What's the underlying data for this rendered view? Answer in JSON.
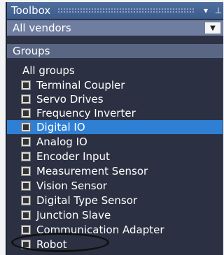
{
  "window": {
    "title": "Toolbox"
  },
  "titlebar_buttons": [
    {
      "label": "▾",
      "icon": "chevron-down-icon"
    },
    {
      "label": "⊥",
      "icon": "pin-icon"
    }
  ],
  "vendor": {
    "selected": "All vendors",
    "arrow": "▼"
  },
  "groups": {
    "header": "Groups"
  },
  "items": [
    {
      "label": "All groups",
      "icon": ""
    },
    {
      "label": "Terminal Coupler",
      "icon": "terminal-coupler-icon"
    },
    {
      "label": "Servo Drives",
      "icon": "servo-drive-icon"
    },
    {
      "label": "Frequency Inverter",
      "icon": "frequency-inverter-icon"
    },
    {
      "label": "Digital IO",
      "icon": "digital-io-icon",
      "selected": true
    },
    {
      "label": "Analog IO",
      "icon": "analog-io-icon"
    },
    {
      "label": "Encoder Input",
      "icon": "encoder-icon"
    },
    {
      "label": "Measurement Sensor",
      "icon": "measurement-sensor-icon"
    },
    {
      "label": "Vision Sensor",
      "icon": "vision-sensor-icon"
    },
    {
      "label": "Digital Type Sensor",
      "icon": "digital-sensor-icon"
    },
    {
      "label": "Junction Slave",
      "icon": "junction-slave-icon"
    },
    {
      "label": "Communication Adapter",
      "icon": "communication-adapter-icon"
    },
    {
      "label": "Robot",
      "icon": "robot-icon"
    }
  ]
}
